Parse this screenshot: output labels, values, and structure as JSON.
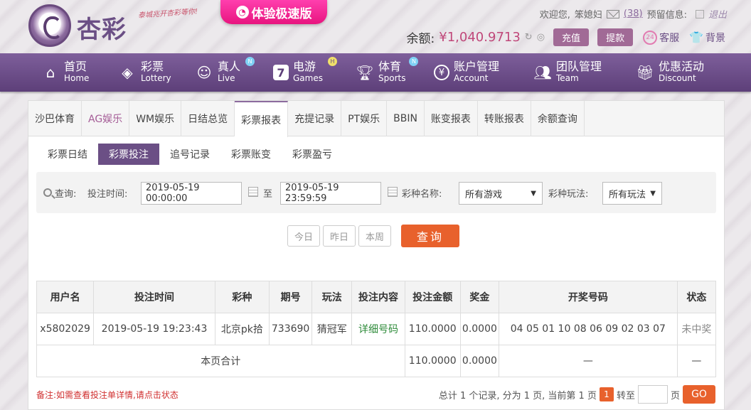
{
  "header": {
    "logo_text": "杏彩",
    "slogan": "泰城兆开杏彩等你!",
    "speed_label": "体验极速版",
    "welcome": "欢迎您,",
    "username": "笨媳妇",
    "mail_count": "(38)",
    "notice_label": "预留信息:",
    "logout": "退出",
    "balance_label": "余额:",
    "balance_value": "¥1,040.9713",
    "deposit": "充值",
    "withdraw": "提款",
    "service": "客服",
    "background": "背景"
  },
  "nav": [
    {
      "cn": "首页",
      "en": "Home",
      "icon": "home-icon"
    },
    {
      "cn": "彩票",
      "en": "Lottery",
      "icon": "ticket-icon"
    },
    {
      "cn": "真人",
      "en": "Live",
      "icon": "dealer-icon",
      "badge": "N"
    },
    {
      "cn": "电游",
      "en": "Games",
      "icon": "seven-icon",
      "badge": "H"
    },
    {
      "cn": "体育",
      "en": "Sports",
      "icon": "trophy-icon",
      "badge": "N"
    },
    {
      "cn": "账户管理",
      "en": "Account",
      "icon": "yen-icon"
    },
    {
      "cn": "团队管理",
      "en": "Team",
      "icon": "team-icon"
    },
    {
      "cn": "优惠活动",
      "en": "Discount",
      "icon": "gift-icon"
    }
  ],
  "tabs": [
    "沙巴体育",
    "AG娱乐",
    "WM娱乐",
    "日结总览",
    "彩票报表",
    "充提记录",
    "PT娱乐",
    "BBIN",
    "账变报表",
    "转账报表",
    "余额查询"
  ],
  "subtabs": [
    "彩票日结",
    "彩票投注",
    "追号记录",
    "彩票账变",
    "彩票盈亏"
  ],
  "filter": {
    "query_label": "查询:",
    "time_label": "投注时间:",
    "start": "2019-05-19 00:00:00",
    "to": "至",
    "end": "2019-05-19 23:59:59",
    "lottery_label": "彩种名称:",
    "lottery_value": "所有游戏",
    "play_label": "彩种玩法:",
    "play_value": "所有玩法"
  },
  "quick": [
    "今日",
    "昨日",
    "本周"
  ],
  "search_label": "查询",
  "table": {
    "headers": [
      "用户名",
      "投注时间",
      "彩种",
      "期号",
      "玩法",
      "投注内容",
      "投注金额",
      "奖金",
      "开奖号码",
      "状态"
    ],
    "rows": [
      [
        "x5802029",
        "2019-05-19 19:23:43",
        "北京pk拾",
        "733690",
        "猜冠军",
        "详细号码",
        "110.0000",
        "0.0000",
        "04 05 01 10 08 06 09 02 03 07",
        "未中奖"
      ]
    ],
    "subtotal": {
      "label": "本页合计",
      "amount": "110.0000",
      "bonus": "0.0000",
      "numbers": "—",
      "status": "—"
    }
  },
  "note": "备注:如需查看投注单详情,请点击状态",
  "pager": {
    "summary": "总计 1 个记录, 分为 1 页, 当前第 1 页",
    "current": "1",
    "goto": "转至",
    "page": "页",
    "go": "GO"
  },
  "colors": {
    "purple": "#6b4f85",
    "orange": "#e8612c",
    "pink": "#e8157f"
  }
}
